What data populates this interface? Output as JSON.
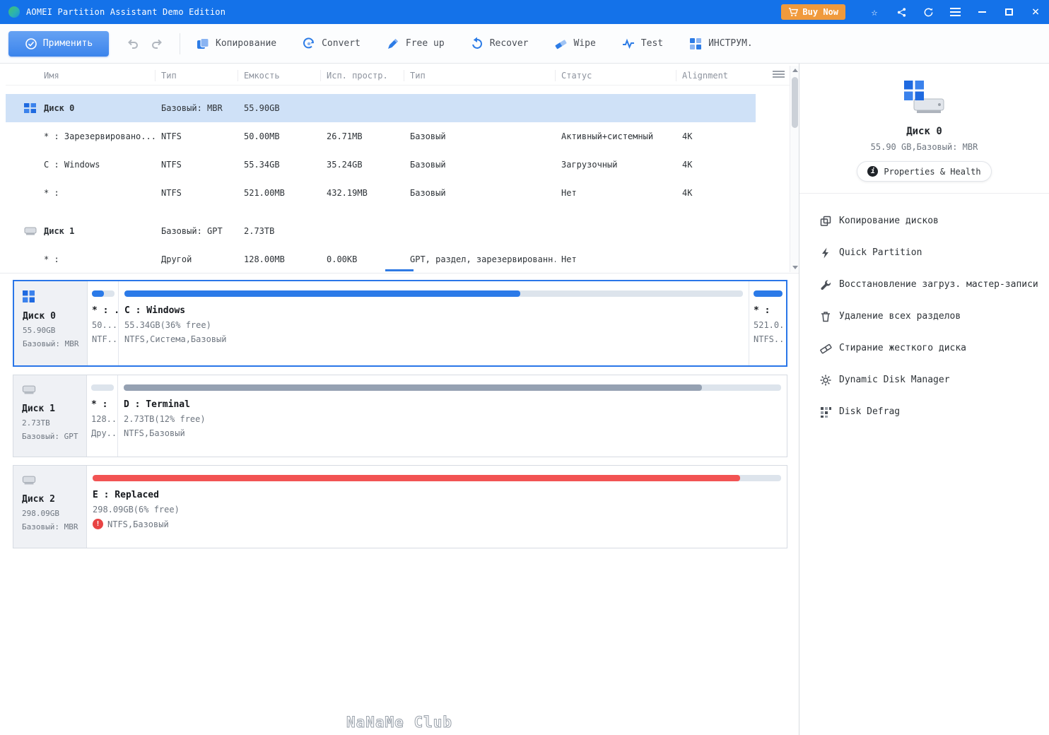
{
  "titlebar": {
    "title": "AOMEI Partition Assistant Demo Edition",
    "buy_now_label": "Buy Now"
  },
  "icons": {
    "star": "☆",
    "close": "×",
    "info": "i",
    "warning": "!"
  },
  "toolbar": {
    "apply_label": "Применить",
    "items": [
      {
        "label": "Копирование"
      },
      {
        "label": "Convert"
      },
      {
        "label": "Free up"
      },
      {
        "label": "Recover"
      },
      {
        "label": "Wipe"
      },
      {
        "label": "Test"
      },
      {
        "label": "ИНСТРУМ."
      }
    ]
  },
  "table": {
    "headers": [
      "Имя",
      "Тип",
      "Емкость",
      "Исп. простр.",
      "Тип",
      "Статус",
      "Alignment"
    ],
    "rows": [
      {
        "name": "Диск 0",
        "fs": "Базовый: MBR",
        "capacity": "55.90GB",
        "used": "",
        "type": "",
        "status": "",
        "alignment": ""
      },
      {
        "name": "* : Зарезервировано...",
        "fs": "NTFS",
        "capacity": "50.00MB",
        "used": "26.71MB",
        "type": "Базовый",
        "status": "Активный+системный",
        "alignment": "4K"
      },
      {
        "name": "C : Windows",
        "fs": "NTFS",
        "capacity": "55.34GB",
        "used": "35.24GB",
        "type": "Базовый",
        "status": "Загрузочный",
        "alignment": "4K"
      },
      {
        "name": "* :",
        "fs": "NTFS",
        "capacity": "521.00MB",
        "used": "432.19MB",
        "type": "Базовый",
        "status": "Нет",
        "alignment": "4K"
      },
      {
        "name": "Диск 1",
        "fs": "Базовый: GPT",
        "capacity": "2.73TB",
        "used": "",
        "type": "",
        "status": "",
        "alignment": ""
      },
      {
        "name": "* :",
        "fs": "Другой",
        "capacity": "128.00MB",
        "used": "0.00KB",
        "type": "GPT, раздел, зарезервированн...",
        "status": "Нет",
        "alignment": ""
      }
    ]
  },
  "disks": [
    {
      "name": "Диск 0",
      "size": "55.90GB",
      "style": "Базовый: MBR",
      "partitions": [
        {
          "name": "* : ...",
          "size": "50....",
          "fs": "NTF...",
          "fill": 53,
          "color": "#2b7ae8"
        },
        {
          "name": "C : Windows",
          "size": "55.34GB(36% free)",
          "fs": "NTFS,Система,Базовый",
          "fill": 64,
          "color": "#2b7ae8"
        },
        {
          "name": "* :",
          "size": "521.0...",
          "fs": "NTFS...",
          "fill": 100,
          "color": "#2b7ae8"
        }
      ]
    },
    {
      "name": "Диск 1",
      "size": "2.73TB",
      "style": "Базовый: GPT",
      "partitions": [
        {
          "name": "* :",
          "size": "128....",
          "fs": "Дру...",
          "fill": 0,
          "color": "#95a1b2"
        },
        {
          "name": "D : Terminal",
          "size": "2.73TB(12% free)",
          "fs": "NTFS,Базовый",
          "fill": 88,
          "color": "#95a1b2"
        }
      ]
    },
    {
      "name": "Диск 2",
      "size": "298.09GB",
      "style": "Базовый: MBR",
      "partitions": [
        {
          "name": "E : Replaced",
          "size": "298.09GB(6% free)",
          "fs": "NTFS,Базовый",
          "fill": 94,
          "color": "#f25353"
        }
      ]
    }
  ],
  "sidebar": {
    "disk_name": "Диск 0",
    "disk_info": "55.90 GB,Базовый: MBR",
    "properties_label": "Properties & Health",
    "menu": [
      {
        "label": "Копирование дисков"
      },
      {
        "label": "Quick Partition"
      },
      {
        "label": "Восстановление загруз. мастер-записи"
      },
      {
        "label": "Удаление всех разделов"
      },
      {
        "label": "Стирание жесткого диска"
      },
      {
        "label": "Dynamic Disk Manager"
      },
      {
        "label": "Disk Defrag"
      }
    ]
  },
  "watermark": "NaNaMe Club"
}
